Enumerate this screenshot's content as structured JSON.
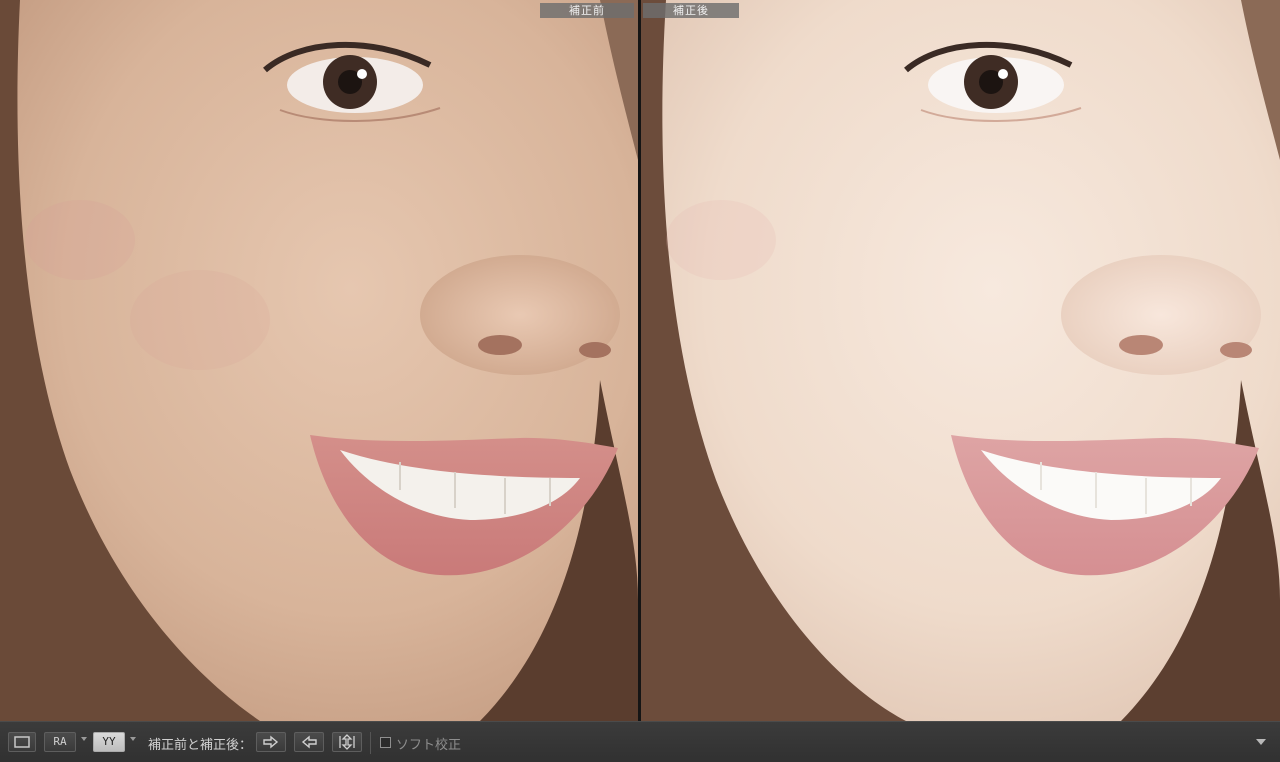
{
  "viewer": {
    "before_label": "補正前",
    "after_label": "補正後"
  },
  "toolbar": {
    "loupe_view_icon": "single-view-icon",
    "ra_button_label": "RA",
    "yy_button_label": "YY",
    "before_after_label": "補正前と補正後：",
    "copy_before_to_after_icon": "arrow-right-icon",
    "copy_after_to_before_icon": "arrow-left-icon",
    "swap_icon": "swap-vertical-icon",
    "soft_proof_label": "ソフト校正",
    "soft_proof_checked": false,
    "toolbar_menu_icon": "chevron-down-icon"
  },
  "colors": {
    "toolbar_bg": "#383838",
    "active_button": "#d0d0d0",
    "label_bg": "#6e6e6e"
  }
}
